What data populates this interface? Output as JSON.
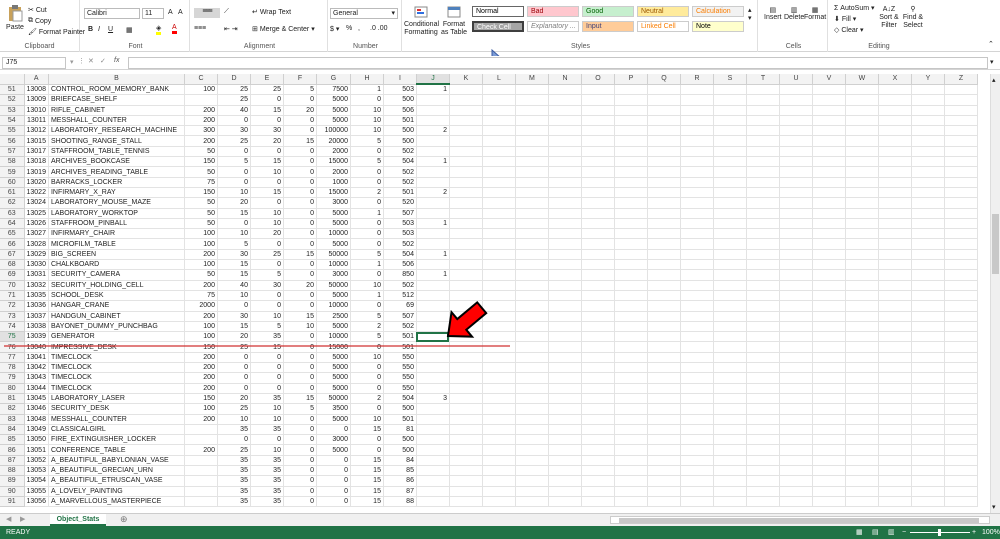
{
  "ribbon": {
    "clipboard": {
      "paste": "Paste",
      "cut": "Cut",
      "copy": "Copy",
      "format_painter": "Format Painter",
      "label": "Clipboard"
    },
    "font": {
      "name": "Calibri",
      "size": "11",
      "label": "Font"
    },
    "alignment": {
      "wrap": "Wrap Text",
      "merge": "Merge & Center",
      "label": "Alignment"
    },
    "number": {
      "format": "General",
      "label": "Number"
    },
    "styles": {
      "conditional": "Conditional Formatting",
      "format_table": "Format as Table",
      "label": "Styles",
      "cells": [
        {
          "text": "Normal",
          "bg": "#ffffff",
          "fg": "#000000"
        },
        {
          "text": "Bad",
          "bg": "#ffc7ce",
          "fg": "#9c0006"
        },
        {
          "text": "Good",
          "bg": "#c6efce",
          "fg": "#006100"
        },
        {
          "text": "Neutral",
          "bg": "#ffeb9c",
          "fg": "#9c5700"
        },
        {
          "text": "Calculation",
          "bg": "#f2f2f2",
          "fg": "#fa7d00"
        },
        {
          "text": "Check Cell",
          "bg": "#a5a5a5",
          "fg": "#ffffff"
        },
        {
          "text": "Explanatory ...",
          "bg": "#ffffff",
          "fg": "#7f7f7f"
        },
        {
          "text": "Input",
          "bg": "#ffcc99",
          "fg": "#3f3f76"
        },
        {
          "text": "Linked Cell",
          "bg": "#ffffff",
          "fg": "#fa7d00"
        },
        {
          "text": "Note",
          "bg": "#ffffcc",
          "fg": "#000000"
        }
      ]
    },
    "cells": {
      "insert": "Insert",
      "delete": "Delete",
      "format": "Format",
      "label": "Cells"
    },
    "editing": {
      "autosum": "AutoSum",
      "fill": "Fill",
      "clear": "Clear",
      "sort": "Sort & Filter",
      "find": "Find & Select",
      "label": "Editing"
    }
  },
  "formula_bar": {
    "name_box": "J75",
    "fx": "fx",
    "content": ""
  },
  "columns": [
    "A",
    "B",
    "C",
    "D",
    "E",
    "F",
    "G",
    "H",
    "I",
    "J",
    "K",
    "L",
    "M",
    "N",
    "O",
    "P",
    "Q",
    "R",
    "S",
    "T",
    "U",
    "V",
    "W",
    "X",
    "Y",
    "Z"
  ],
  "rows": [
    {
      "r": "51",
      "a": "13008",
      "b": "CONTROL_ROOM_MEMORY_BANK",
      "c": "100",
      "d": "25",
      "e": "25",
      "f": "5",
      "g": "7500",
      "h": "1",
      "i": "503",
      "j": "1"
    },
    {
      "r": "52",
      "a": "13009",
      "b": "BRIEFCASE_SHELF",
      "c": "",
      "d": "25",
      "e": "0",
      "f": "0",
      "g": "5000",
      "h": "0",
      "i": "500",
      "j": ""
    },
    {
      "r": "53",
      "a": "13010",
      "b": "RIFLE_CABINET",
      "c": "200",
      "d": "40",
      "e": "15",
      "f": "20",
      "g": "5000",
      "h": "10",
      "i": "506",
      "j": ""
    },
    {
      "r": "54",
      "a": "13011",
      "b": "MESSHALL_COUNTER",
      "c": "200",
      "d": "0",
      "e": "0",
      "f": "0",
      "g": "5000",
      "h": "10",
      "i": "501",
      "j": ""
    },
    {
      "r": "55",
      "a": "13012",
      "b": "LABORATORY_RESEARCH_MACHINE",
      "c": "300",
      "d": "30",
      "e": "30",
      "f": "0",
      "g": "100000",
      "h": "10",
      "i": "500",
      "j": "2"
    },
    {
      "r": "56",
      "a": "13015",
      "b": "SHOOTING_RANGE_STALL",
      "c": "200",
      "d": "25",
      "e": "20",
      "f": "15",
      "g": "20000",
      "h": "5",
      "i": "500",
      "j": ""
    },
    {
      "r": "57",
      "a": "13017",
      "b": "STAFFROOM_TABLE_TENNIS",
      "c": "50",
      "d": "0",
      "e": "0",
      "f": "0",
      "g": "2000",
      "h": "0",
      "i": "502",
      "j": ""
    },
    {
      "r": "58",
      "a": "13018",
      "b": "ARCHIVES_BOOKCASE",
      "c": "150",
      "d": "5",
      "e": "15",
      "f": "0",
      "g": "15000",
      "h": "5",
      "i": "504",
      "j": "1"
    },
    {
      "r": "59",
      "a": "13019",
      "b": "ARCHIVES_READING_TABLE",
      "c": "50",
      "d": "0",
      "e": "10",
      "f": "0",
      "g": "2000",
      "h": "0",
      "i": "502",
      "j": ""
    },
    {
      "r": "60",
      "a": "13020",
      "b": "BARRACKS_LOCKER",
      "c": "75",
      "d": "0",
      "e": "0",
      "f": "0",
      "g": "1000",
      "h": "0",
      "i": "502",
      "j": ""
    },
    {
      "r": "61",
      "a": "13022",
      "b": "INFIRMARY_X_RAY",
      "c": "150",
      "d": "10",
      "e": "15",
      "f": "0",
      "g": "15000",
      "h": "2",
      "i": "501",
      "j": "2"
    },
    {
      "r": "62",
      "a": "13024",
      "b": "LABORATORY_MOUSE_MAZE",
      "c": "50",
      "d": "20",
      "e": "0",
      "f": "0",
      "g": "3000",
      "h": "0",
      "i": "520",
      "j": ""
    },
    {
      "r": "63",
      "a": "13025",
      "b": "LABORATORY_WORKTOP",
      "c": "50",
      "d": "15",
      "e": "10",
      "f": "0",
      "g": "5000",
      "h": "1",
      "i": "507",
      "j": ""
    },
    {
      "r": "64",
      "a": "13026",
      "b": "STAFFROOM_PINBALL",
      "c": "50",
      "d": "0",
      "e": "10",
      "f": "0",
      "g": "5000",
      "h": "0",
      "i": "503",
      "j": "1"
    },
    {
      "r": "65",
      "a": "13027",
      "b": "INFIRMARY_CHAIR",
      "c": "100",
      "d": "10",
      "e": "20",
      "f": "0",
      "g": "10000",
      "h": "0",
      "i": "503",
      "j": ""
    },
    {
      "r": "66",
      "a": "13028",
      "b": "MICROFILM_TABLE",
      "c": "100",
      "d": "5",
      "e": "0",
      "f": "0",
      "g": "5000",
      "h": "0",
      "i": "502",
      "j": ""
    },
    {
      "r": "67",
      "a": "13029",
      "b": "BIG_SCREEN",
      "c": "200",
      "d": "30",
      "e": "25",
      "f": "15",
      "g": "50000",
      "h": "5",
      "i": "504",
      "j": "1"
    },
    {
      "r": "68",
      "a": "13030",
      "b": "CHALKBOARD",
      "c": "100",
      "d": "15",
      "e": "0",
      "f": "0",
      "g": "10000",
      "h": "1",
      "i": "506",
      "j": ""
    },
    {
      "r": "69",
      "a": "13031",
      "b": "SECURITY_CAMERA",
      "c": "50",
      "d": "15",
      "e": "5",
      "f": "0",
      "g": "3000",
      "h": "0",
      "i": "850",
      "j": "1"
    },
    {
      "r": "70",
      "a": "13032",
      "b": "SECURITY_HOLDING_CELL",
      "c": "200",
      "d": "40",
      "e": "30",
      "f": "20",
      "g": "50000",
      "h": "10",
      "i": "502",
      "j": ""
    },
    {
      "r": "71",
      "a": "13035",
      "b": "SCHOOL_DESK",
      "c": "75",
      "d": "10",
      "e": "0",
      "f": "0",
      "g": "5000",
      "h": "1",
      "i": "512",
      "j": ""
    },
    {
      "r": "72",
      "a": "13036",
      "b": "HANGAR_CRANE",
      "c": "2000",
      "d": "0",
      "e": "0",
      "f": "0",
      "g": "10000",
      "h": "0",
      "i": "69",
      "j": ""
    },
    {
      "r": "73",
      "a": "13037",
      "b": "HANDGUN_CABINET",
      "c": "200",
      "d": "30",
      "e": "10",
      "f": "15",
      "g": "2500",
      "h": "5",
      "i": "507",
      "j": ""
    },
    {
      "r": "74",
      "a": "13038",
      "b": "BAYONET_DUMMY_PUNCHBAG",
      "c": "100",
      "d": "15",
      "e": "5",
      "f": "10",
      "g": "5000",
      "h": "2",
      "i": "502",
      "j": ""
    },
    {
      "r": "75",
      "a": "13039",
      "b": "GENERATOR",
      "c": "100",
      "d": "20",
      "e": "35",
      "f": "0",
      "g": "10000",
      "h": "5",
      "i": "501",
      "j": ""
    },
    {
      "r": "76",
      "a": "13040",
      "b": "IMPRESSIVE_DESK",
      "c": "150",
      "d": "25",
      "e": "15",
      "f": "0",
      "g": "15000",
      "h": "0",
      "i": "501",
      "j": ""
    },
    {
      "r": "77",
      "a": "13041",
      "b": "TIMECLOCK",
      "c": "200",
      "d": "0",
      "e": "0",
      "f": "0",
      "g": "5000",
      "h": "10",
      "i": "550",
      "j": ""
    },
    {
      "r": "78",
      "a": "13042",
      "b": "TIMECLOCK",
      "c": "200",
      "d": "0",
      "e": "0",
      "f": "0",
      "g": "5000",
      "h": "0",
      "i": "550",
      "j": ""
    },
    {
      "r": "79",
      "a": "13043",
      "b": "TIMECLOCK",
      "c": "200",
      "d": "0",
      "e": "0",
      "f": "0",
      "g": "5000",
      "h": "0",
      "i": "550",
      "j": ""
    },
    {
      "r": "80",
      "a": "13044",
      "b": "TIMECLOCK",
      "c": "200",
      "d": "0",
      "e": "0",
      "f": "0",
      "g": "5000",
      "h": "0",
      "i": "550",
      "j": ""
    },
    {
      "r": "81",
      "a": "13045",
      "b": "LABORATORY_LASER",
      "c": "150",
      "d": "20",
      "e": "35",
      "f": "15",
      "g": "50000",
      "h": "2",
      "i": "504",
      "j": "3"
    },
    {
      "r": "82",
      "a": "13046",
      "b": "SECURITY_DESK",
      "c": "100",
      "d": "25",
      "e": "10",
      "f": "5",
      "g": "3500",
      "h": "0",
      "i": "500",
      "j": ""
    },
    {
      "r": "83",
      "a": "13048",
      "b": "MESSHALL_COUNTER",
      "c": "200",
      "d": "10",
      "e": "10",
      "f": "0",
      "g": "5000",
      "h": "10",
      "i": "501",
      "j": ""
    },
    {
      "r": "84",
      "a": "13049",
      "b": "CLASSICALGIRL",
      "c": "",
      "d": "35",
      "e": "35",
      "f": "0",
      "g": "0",
      "h": "15",
      "i": "81",
      "j": ""
    },
    {
      "r": "85",
      "a": "13050",
      "b": "FIRE_EXTINGUISHER_LOCKER",
      "c": "",
      "d": "0",
      "e": "0",
      "f": "0",
      "g": "3000",
      "h": "0",
      "i": "500",
      "j": ""
    },
    {
      "r": "86",
      "a": "13051",
      "b": "CONFERENCE_TABLE",
      "c": "200",
      "d": "25",
      "e": "10",
      "f": "0",
      "g": "5000",
      "h": "0",
      "i": "500",
      "j": ""
    },
    {
      "r": "87",
      "a": "13052",
      "b": "A_BEAUTIFUL_BABYLONIAN_VASE",
      "c": "",
      "d": "35",
      "e": "35",
      "f": "0",
      "g": "0",
      "h": "15",
      "i": "84",
      "j": ""
    },
    {
      "r": "88",
      "a": "13053",
      "b": "A_BEAUTIFUL_GRECIAN_URN",
      "c": "",
      "d": "35",
      "e": "35",
      "f": "0",
      "g": "0",
      "h": "15",
      "i": "85",
      "j": ""
    },
    {
      "r": "89",
      "a": "13054",
      "b": "A_BEAUTIFUL_ETRUSCAN_VASE",
      "c": "",
      "d": "35",
      "e": "35",
      "f": "0",
      "g": "0",
      "h": "15",
      "i": "86",
      "j": ""
    },
    {
      "r": "90",
      "a": "13055",
      "b": "A_LOVELY_PAINTING",
      "c": "",
      "d": "35",
      "e": "35",
      "f": "0",
      "g": "0",
      "h": "15",
      "i": "87",
      "j": ""
    },
    {
      "r": "91",
      "a": "13056",
      "b": "A_MARVELLOUS_MASTERPIECE",
      "c": "",
      "d": "35",
      "e": "35",
      "f": "0",
      "g": "0",
      "h": "15",
      "i": "88",
      "j": ""
    }
  ],
  "selected": {
    "row": "75",
    "col": "J"
  },
  "sheet_tab": "Object_Stats",
  "status": {
    "ready": "READY",
    "zoom": "100%"
  },
  "colors": {
    "accent": "#217346",
    "annotation": "#e00000"
  }
}
